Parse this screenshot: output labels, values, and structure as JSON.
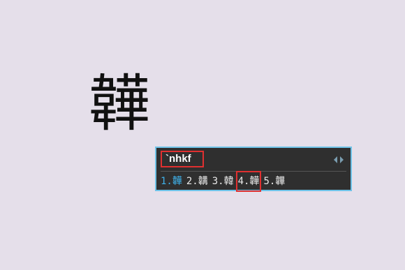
{
  "display": {
    "character": "韡"
  },
  "ime": {
    "composition": "`nhkf",
    "candidates": [
      {
        "label": "1.韡"
      },
      {
        "label": "2.韝"
      },
      {
        "label": "3.韓"
      },
      {
        "label": "4.韡"
      },
      {
        "label": "5.韠"
      }
    ],
    "border_color": "#6fc3e8",
    "selected_color": "#3fb0e8",
    "highlight_color": "#e03030"
  }
}
